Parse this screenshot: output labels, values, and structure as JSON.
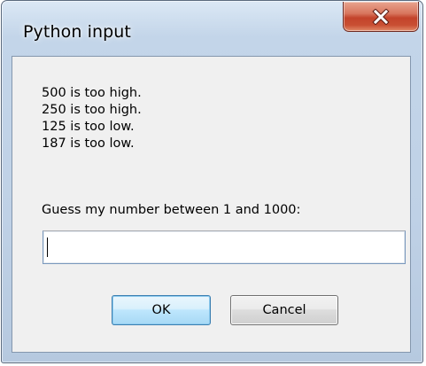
{
  "window": {
    "title": "Python input"
  },
  "title_bar": {
    "close_icon": "close-icon",
    "close_color": "#c94f33"
  },
  "message": {
    "lines": [
      "500 is too high.",
      "250 is too high.",
      "125 is too low.",
      "187 is too low."
    ]
  },
  "prompt": {
    "label": "Guess my number between 1 and 1000:",
    "value": ""
  },
  "buttons": {
    "ok_label": "OK",
    "cancel_label": "Cancel"
  },
  "colors": {
    "frame": "#bfd1e6",
    "client_background": "#f0f0f0",
    "default_button": "#bee6fd"
  }
}
